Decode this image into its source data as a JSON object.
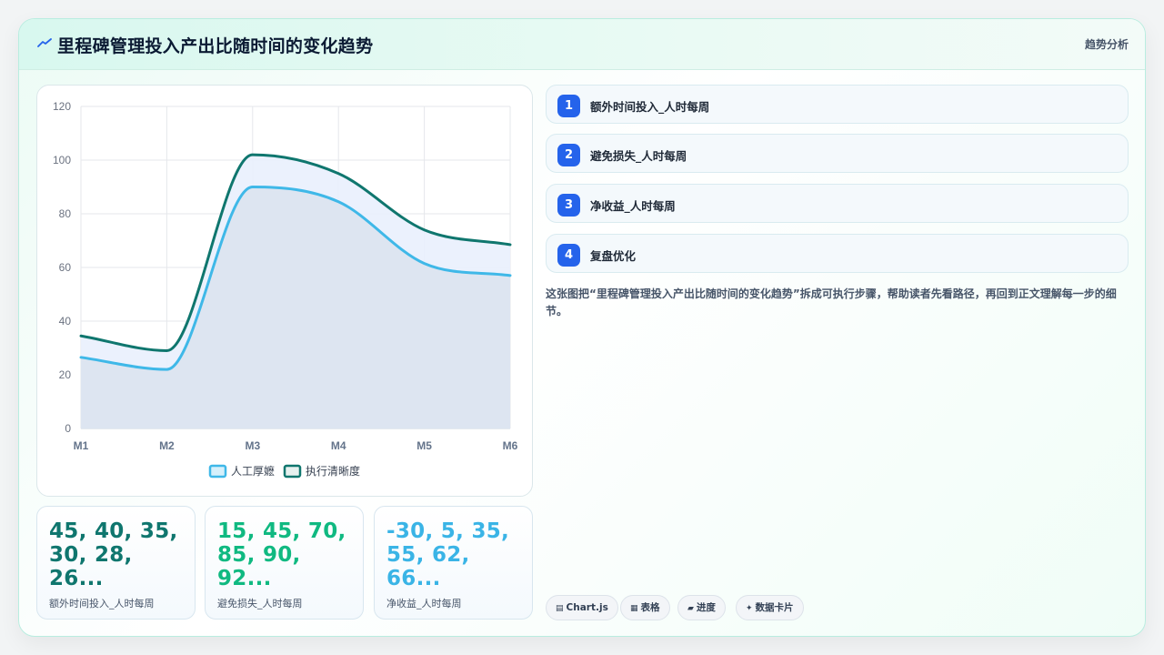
{
  "header": {
    "title": "里程碑管理投入产出比随时间的变化趋势",
    "tag": "趋势分析",
    "icon": "trend-line-icon"
  },
  "chart_data": {
    "type": "area",
    "x": [
      "M1",
      "M2",
      "M3",
      "M4",
      "M5",
      "M6"
    ],
    "yticks": [
      "0",
      "20",
      "40",
      "60",
      "80",
      "100",
      "120"
    ],
    "ylim": [
      0,
      120
    ],
    "grid": true,
    "legend_position": "bottom",
    "series": [
      {
        "name": "人工厚嬷",
        "values": [
          26.5,
          22,
          90,
          84.5,
          61.5,
          57
        ],
        "color": "#3fb8e8",
        "fill": "#dbe3ef"
      },
      {
        "name": "执行清晰度",
        "values": [
          34.5,
          29,
          102,
          95,
          74,
          68.5
        ],
        "color": "#0f766e",
        "fill": "#e9effd"
      }
    ]
  },
  "stats": [
    {
      "value": "45, 40, 35, 30, 28, 26...",
      "label": "额外时间投入_人时每周",
      "color": "#0f766e"
    },
    {
      "value": "15, 45, 70, 85, 90, 92...",
      "label": "避免损失_人时每周",
      "color": "#10b981"
    },
    {
      "value": "-30, 5, 35, 55, 62, 66...",
      "label": "净收益_人时每周",
      "color": "#3ab4e6"
    }
  ],
  "steps": [
    {
      "num": "1",
      "label": "额外时间投入_人时每周"
    },
    {
      "num": "2",
      "label": "避免损失_人时每周"
    },
    {
      "num": "3",
      "label": "净收益_人时每周"
    },
    {
      "num": "4",
      "label": "复盘优化"
    }
  ],
  "description": "这张图把“里程碑管理投入产出比随时间的变化趋势”拆成可执行步骤，帮助读者先看路径，再回到正文理解每一步的细节。",
  "pills": [
    {
      "icon": "▤",
      "label": "Chart.js"
    },
    {
      "icon": "▦",
      "label": "表格"
    },
    {
      "icon": "▰",
      "label": "进度"
    },
    {
      "icon": "✦",
      "label": "数据卡片"
    }
  ]
}
